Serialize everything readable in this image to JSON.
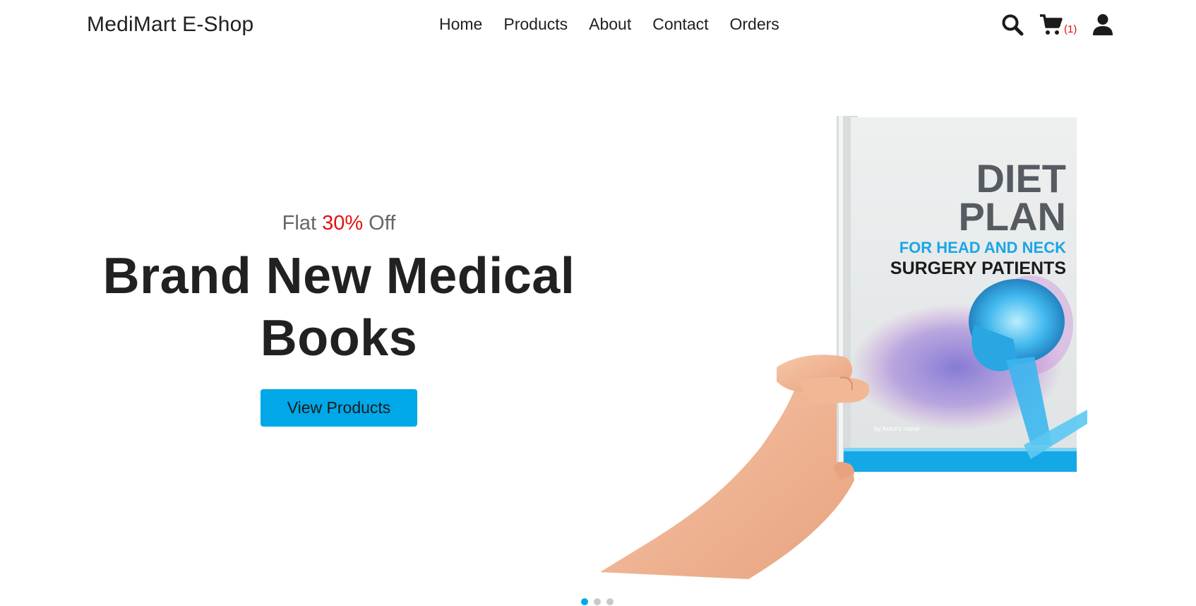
{
  "header": {
    "brand": "MediMart E-Shop",
    "nav": [
      "Home",
      "Products",
      "About",
      "Contact",
      "Orders"
    ],
    "cart_count": "(1)",
    "icons": [
      "search-icon",
      "cart-icon",
      "user-icon"
    ]
  },
  "hero": {
    "offer_prefix": "Flat ",
    "offer_percent": "30%",
    "offer_suffix": " Off",
    "headline_line1": "Brand New Medical",
    "headline_line2": "Books",
    "cta_label": "View Products",
    "book": {
      "title_line1": "DIET",
      "title_line2": "PLAN",
      "subtitle1": "FOR HEAD AND NECK",
      "subtitle2": "SURGERY PATIENTS",
      "author": "by Autor's name"
    }
  },
  "carousel": {
    "slides": 3,
    "active": 1
  },
  "colors": {
    "accent": "#00a8e8",
    "offer_red": "#e41111",
    "text_dark": "#212121"
  }
}
